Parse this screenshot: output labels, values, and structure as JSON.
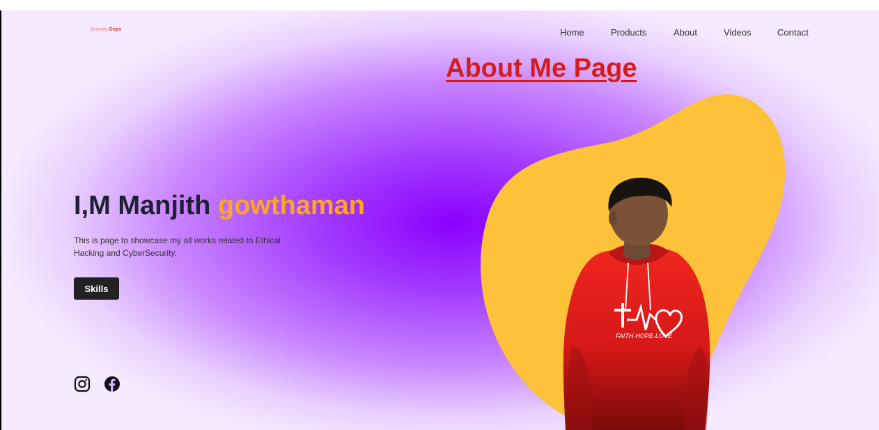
{
  "logo": {
    "part1": "Security",
    "part2": "Oops"
  },
  "nav": {
    "items": [
      "Home",
      "Products",
      "About",
      "Videos",
      "Contact"
    ]
  },
  "page_heading": "About Me Page",
  "hero": {
    "name_prefix": "I,M Manjith ",
    "name_highlight": "gowthaman",
    "description": "This is page to showcase my all works related to Ethical Hacking and CyberSecurity.",
    "skills_button": "Skills"
  },
  "hoodie_text": "FAITH·HOPE·LOVE",
  "social": {
    "icons": [
      "instagram-icon",
      "facebook-icon"
    ]
  },
  "colors": {
    "accent": "#ffa51f",
    "heading": "#d61b1b",
    "blob": "#fdc23a",
    "hoodie": "#e21d1d"
  }
}
